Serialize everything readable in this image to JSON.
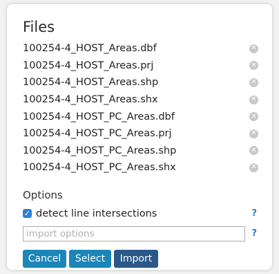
{
  "files_title": "Files",
  "files": [
    {
      "name": "100254-4_HOST_Areas.dbf"
    },
    {
      "name": "100254-4_HOST_Areas.prj"
    },
    {
      "name": "100254-4_HOST_Areas.shp"
    },
    {
      "name": "100254-4_HOST_Areas.shx"
    },
    {
      "name": "100254-4_HOST_PC_Areas.dbf"
    },
    {
      "name": "100254-4_HOST_PC_Areas.prj"
    },
    {
      "name": "100254-4_HOST_PC_Areas.shp"
    },
    {
      "name": "100254-4_HOST_PC_Areas.shx"
    }
  ],
  "remove_glyph": "✕",
  "options_title": "Options",
  "detect_intersections": {
    "label": "detect line intersections",
    "checked": true,
    "check_glyph": "✓",
    "help": "?"
  },
  "import_options": {
    "value": "",
    "placeholder": "import options",
    "help": "?"
  },
  "buttons": {
    "cancel": "Cancel",
    "select": "Select",
    "import": "Import"
  },
  "colors": {
    "accent": "#1c86b9",
    "import_button": "#2a5888",
    "checkbox": "#2e7ed6",
    "help": "#2a7fc9",
    "remove_icon": "#c8c8c8"
  }
}
